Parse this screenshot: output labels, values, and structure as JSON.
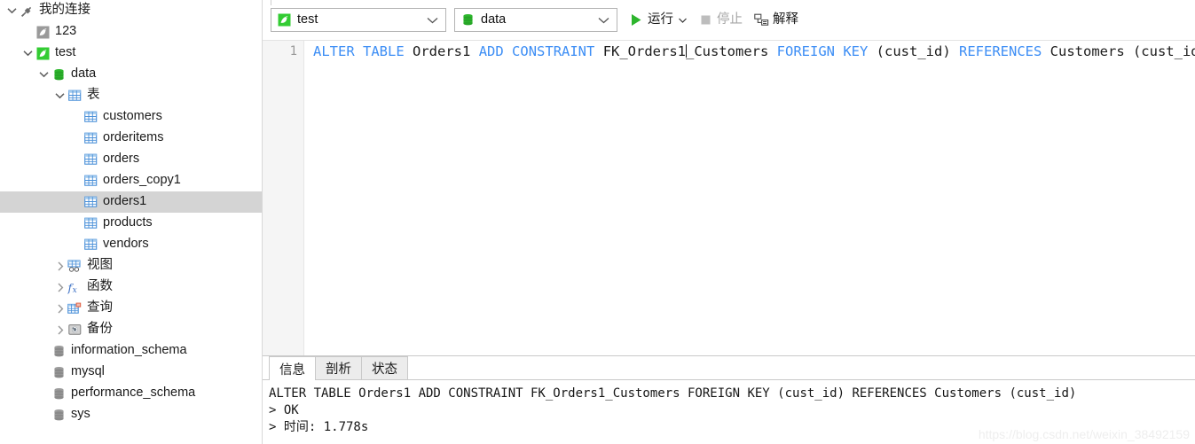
{
  "sidebar": {
    "items": [
      {
        "label": "我的连接",
        "icon": "plug-icon",
        "indent": 0,
        "twisty": "down",
        "selected": false
      },
      {
        "label": "123",
        "icon": "dolphin-gray-icon",
        "indent": 1,
        "twisty": "none",
        "selected": false
      },
      {
        "label": "test",
        "icon": "dolphin-green-icon",
        "indent": 1,
        "twisty": "down",
        "selected": false
      },
      {
        "label": "data",
        "icon": "database-green-icon",
        "indent": 2,
        "twisty": "down",
        "selected": false
      },
      {
        "label": "表",
        "icon": "table-grid-icon",
        "indent": 3,
        "twisty": "down",
        "selected": false
      },
      {
        "label": "customers",
        "icon": "table-grid-icon",
        "indent": 4,
        "twisty": "none",
        "selected": false
      },
      {
        "label": "orderitems",
        "icon": "table-grid-icon",
        "indent": 4,
        "twisty": "none",
        "selected": false
      },
      {
        "label": "orders",
        "icon": "table-grid-icon",
        "indent": 4,
        "twisty": "none",
        "selected": false
      },
      {
        "label": "orders_copy1",
        "icon": "table-grid-icon",
        "indent": 4,
        "twisty": "none",
        "selected": false
      },
      {
        "label": "orders1",
        "icon": "table-grid-icon",
        "indent": 4,
        "twisty": "none",
        "selected": true
      },
      {
        "label": "products",
        "icon": "table-grid-icon",
        "indent": 4,
        "twisty": "none",
        "selected": false
      },
      {
        "label": "vendors",
        "icon": "table-grid-icon",
        "indent": 4,
        "twisty": "none",
        "selected": false
      },
      {
        "label": "视图",
        "icon": "view-icon",
        "indent": 3,
        "twisty": "right",
        "selected": false
      },
      {
        "label": "函数",
        "icon": "function-fx-icon",
        "indent": 3,
        "twisty": "right",
        "selected": false
      },
      {
        "label": "查询",
        "icon": "query-icon",
        "indent": 3,
        "twisty": "right",
        "selected": false
      },
      {
        "label": "备份",
        "icon": "backup-disk-icon",
        "indent": 3,
        "twisty": "right",
        "selected": false
      },
      {
        "label": "information_schema",
        "icon": "database-gray-icon",
        "indent": 2,
        "twisty": "none",
        "selected": false
      },
      {
        "label": "mysql",
        "icon": "database-gray-icon",
        "indent": 2,
        "twisty": "none",
        "selected": false
      },
      {
        "label": "performance_schema",
        "icon": "database-gray-icon",
        "indent": 2,
        "twisty": "none",
        "selected": false
      },
      {
        "label": "sys",
        "icon": "database-gray-icon",
        "indent": 2,
        "twisty": "none",
        "selected": false
      }
    ]
  },
  "toolbar": {
    "connection_select": {
      "value": "test",
      "icon": "dolphin-green-icon"
    },
    "database_select": {
      "value": "data",
      "icon": "database-green-icon"
    },
    "run_label": "运行",
    "stop_label": "停止",
    "explain_label": "解释",
    "run_icon": "play-icon",
    "stop_icon": "stop-square-icon",
    "explain_icon": "explain-icon"
  },
  "editor": {
    "line_number": "1",
    "sql_tokens": [
      {
        "t": "ALTER",
        "kw": true
      },
      {
        "t": " ",
        "kw": false
      },
      {
        "t": "TABLE",
        "kw": true
      },
      {
        "t": " Orders1 ",
        "kw": false
      },
      {
        "t": "ADD",
        "kw": true
      },
      {
        "t": " ",
        "kw": false
      },
      {
        "t": "CONSTRAINT",
        "kw": true
      },
      {
        "t": " FK_Orders1",
        "kw": false
      },
      {
        "t": "CARET",
        "kw": false
      },
      {
        "t": "_Customers ",
        "kw": false
      },
      {
        "t": "FOREIGN",
        "kw": true
      },
      {
        "t": " ",
        "kw": false
      },
      {
        "t": "KEY",
        "kw": true
      },
      {
        "t": " (cust_id) ",
        "kw": false
      },
      {
        "t": "REFERENCES",
        "kw": true
      },
      {
        "t": " Customers (cust_id);",
        "kw": false
      }
    ]
  },
  "results": {
    "tabs": [
      {
        "label": "信息",
        "active": true
      },
      {
        "label": "剖析",
        "active": false
      },
      {
        "label": "状态",
        "active": false
      }
    ],
    "output_lines": [
      "ALTER TABLE Orders1 ADD CONSTRAINT FK_Orders1_Customers FOREIGN KEY (cust_id) REFERENCES Customers (cust_id)",
      "> OK",
      "> 时间: 1.778s"
    ]
  },
  "watermark": "https://blog.csdn.net/weixin_38492159",
  "colors": {
    "accent_green": "#2db52d",
    "keyword_blue": "#3d8ef5",
    "selection_gray": "#d4d4d4",
    "table_icon_blue": "#4a90d9"
  }
}
